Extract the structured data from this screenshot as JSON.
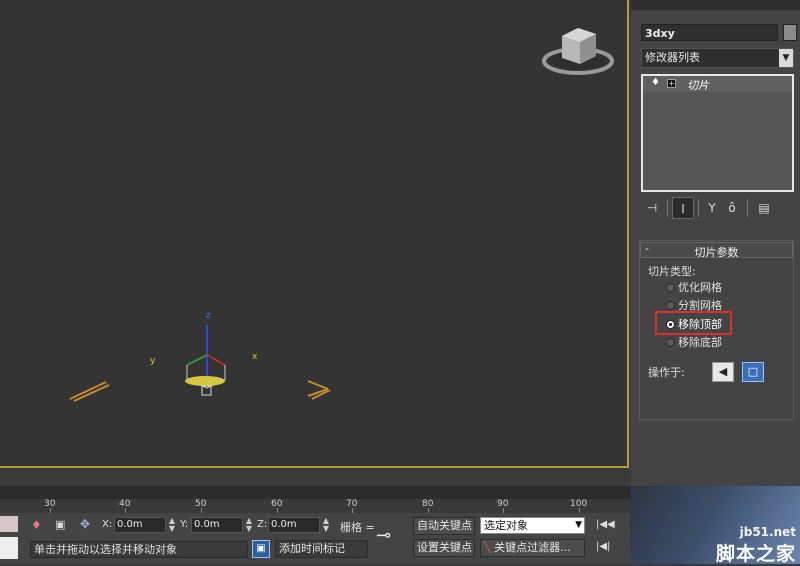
{
  "command_panel": {
    "object_name": "3dxy",
    "modifier_list": "修改器列表",
    "stack_item": "切片",
    "tools": [
      "pin-stack-icon",
      "show-end-result-icon",
      "make-unique-icon",
      "remove-modifier-icon",
      "configure-sets-icon"
    ]
  },
  "rollout": {
    "title": "切片参数",
    "slice_type_label": "切片类型:",
    "options": [
      "优化网格",
      "分割网格",
      "移除顶部",
      "移除底部"
    ],
    "selected": "移除顶部",
    "operate_on_label": "操作于:"
  },
  "viewport": {
    "axis_x": "x",
    "axis_y": "y",
    "axis_z": "z"
  },
  "timeline": {
    "ticks": [
      "30",
      "40",
      "50",
      "60",
      "70",
      "80",
      "90",
      "100"
    ]
  },
  "status": {
    "x_label": "X:",
    "x_value": "0.0m",
    "y_label": "Y:",
    "y_value": "0.0m",
    "z_label": "Z:",
    "z_value": "0.0m",
    "grid_label": "栅格 =",
    "prompt": "单击并拖动以选择并移动对象",
    "add_time_tag": "添加时间标记",
    "auto_key": "自动关键点",
    "set_key": "设置关键点",
    "selection_dropdown": "选定对象",
    "key_filters": "关键点过滤器..."
  },
  "watermark": {
    "line1": "jb51.net",
    "line2": "脚本之家"
  },
  "colors": {
    "viewport_border": "#b89a3a",
    "highlight_box": "#d93030",
    "viewport_bg": "#343434"
  }
}
